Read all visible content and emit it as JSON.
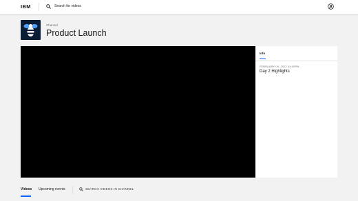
{
  "header": {
    "logo": "IBM",
    "search_placeholder": "Search for videos",
    "icons": {
      "search": "search-icon",
      "user": "user-avatar-icon"
    }
  },
  "channel": {
    "eyebrow": "Channel",
    "title": "Product Launch",
    "logo_icon": "bee-logo-icon"
  },
  "info_panel": {
    "tab_label": "Info",
    "date": "FEBRUARY 09, 2022 04:00PM",
    "video_title": "Day 2 Highlights"
  },
  "bottom_tabs": {
    "items": [
      {
        "label": "Videos",
        "selected": true
      },
      {
        "label": "Upcoming events",
        "selected": false
      }
    ],
    "search_label": "SEARCH VIDEOS IN CHANNEL"
  },
  "colors": {
    "accent": "#0f62fe",
    "page_bg": "#f2f2f2",
    "player_bg": "#000000",
    "logo_bg": "#0b1d35"
  }
}
